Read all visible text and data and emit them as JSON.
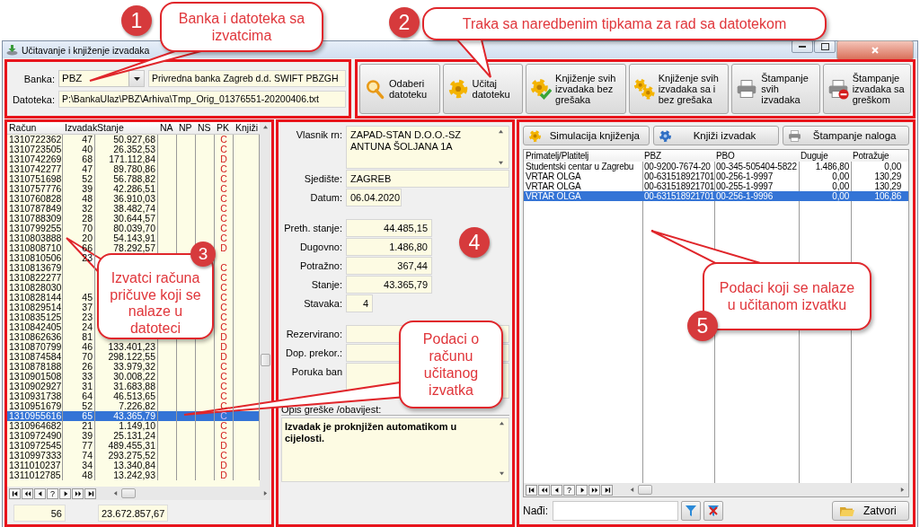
{
  "window": {
    "title": "Učitavanje i knjiženje izvadaka"
  },
  "bank": {
    "label": "Banka:",
    "code": "PBZ",
    "name": "Privredna banka Zagreb d.d. SWIFT PBZGH",
    "file_label": "Datoteka:",
    "file": "P:\\BankaUlaz\\PBZ\\Arhiva\\Tmp_Orig_01376551-20200406.txt"
  },
  "toolbar": [
    {
      "kind": "search",
      "label": "Odaberi datoteku"
    },
    {
      "kind": "gear",
      "label": "Učitaj datoteku"
    },
    {
      "kind": "gear-check",
      "label": "Knjiženje svih izvadaka bez grešaka"
    },
    {
      "kind": "gears",
      "label": "Knjiženje svih izvadaka sa i bez grešaka"
    },
    {
      "kind": "printer",
      "label": "Štampanje svih izvadaka"
    },
    {
      "kind": "printer-error",
      "label": "Štampanje izvadaka sa greškom"
    }
  ],
  "accounts": {
    "columns": [
      "Račun",
      "Izvadak",
      "Stanje",
      "NA",
      "NP",
      "NS",
      "PK",
      "Knjiži"
    ],
    "rows": [
      {
        "account": "1310722362",
        "statement": "47",
        "balance": "50.927,68",
        "pk": "C",
        "selected": false
      },
      {
        "account": "1310723505",
        "statement": "40",
        "balance": "26.352,53",
        "pk": "C",
        "selected": false
      },
      {
        "account": "1310742269",
        "statement": "68",
        "balance": "171.112,84",
        "pk": "D",
        "selected": false
      },
      {
        "account": "1310742277",
        "statement": "47",
        "balance": "89.780,86",
        "pk": "C",
        "selected": false
      },
      {
        "account": "1310751698",
        "statement": "52",
        "balance": "56.788,82",
        "pk": "C",
        "selected": false
      },
      {
        "account": "1310757776",
        "statement": "39",
        "balance": "42.286,51",
        "pk": "C",
        "selected": false
      },
      {
        "account": "1310760828",
        "statement": "48",
        "balance": "36.910,03",
        "pk": "C",
        "selected": false
      },
      {
        "account": "1310787849",
        "statement": "32",
        "balance": "38.482,74",
        "pk": "C",
        "selected": false
      },
      {
        "account": "1310788309",
        "statement": "28",
        "balance": "30.644,57",
        "pk": "C",
        "selected": false
      },
      {
        "account": "1310799255",
        "statement": "70",
        "balance": "80.039,70",
        "pk": "C",
        "selected": false
      },
      {
        "account": "1310803888",
        "statement": "20",
        "balance": "54.143,91",
        "pk": "C",
        "selected": false
      },
      {
        "account": "1310808710",
        "statement": "66",
        "balance": "78.292,57",
        "pk": "D",
        "selected": false
      },
      {
        "account": "1310810506",
        "statement": "23",
        "selected": false
      },
      {
        "account": "1310813679",
        "pk": "C",
        "selected": false
      },
      {
        "account": "1310822277",
        "pk": "C",
        "selected": false
      },
      {
        "account": "1310828030",
        "pk": "C",
        "selected": false
      },
      {
        "account": "1310828144",
        "statement": "45",
        "pk": "C",
        "selected": false
      },
      {
        "account": "1310829514",
        "statement": "37",
        "pk": "C",
        "selected": false
      },
      {
        "account": "1310835125",
        "statement": "23",
        "pk": "C",
        "selected": false
      },
      {
        "account": "1310842405",
        "statement": "24",
        "pk": "C",
        "selected": false
      },
      {
        "account": "1310862636",
        "statement": "81",
        "pk": "D",
        "selected": false
      },
      {
        "account": "1310870799",
        "statement": "46",
        "balance": "133.401,23",
        "pk": "D",
        "selected": false
      },
      {
        "account": "1310874584",
        "statement": "70",
        "balance": "298.122,55",
        "pk": "D",
        "selected": false
      },
      {
        "account": "1310878188",
        "statement": "26",
        "balance": "33.979,32",
        "pk": "C",
        "selected": false
      },
      {
        "account": "1310901508",
        "statement": "33",
        "balance": "30.008,22",
        "pk": "C",
        "selected": false
      },
      {
        "account": "1310902927",
        "statement": "31",
        "balance": "31.683,88",
        "pk": "C",
        "selected": false
      },
      {
        "account": "1310931738",
        "statement": "64",
        "balance": "46.513,65",
        "pk": "C",
        "selected": false
      },
      {
        "account": "1310951679",
        "statement": "52",
        "balance": "7.226,82",
        "pk": "C",
        "selected": false
      },
      {
        "account": "1310955616",
        "statement": "65",
        "balance": "43.365,79",
        "pk": "C",
        "selected": true
      },
      {
        "account": "1310964682",
        "statement": "21",
        "balance": "1.149,10",
        "pk": "C",
        "selected": false
      },
      {
        "account": "1310972490",
        "statement": "39",
        "balance": "25.131,24",
        "pk": "C",
        "selected": false
      },
      {
        "account": "1310972545",
        "statement": "77",
        "balance": "489.455,31",
        "pk": "D",
        "selected": false
      },
      {
        "account": "1310997333",
        "statement": "74",
        "balance": "293.275,52",
        "pk": "C",
        "selected": false
      },
      {
        "account": "1311010237",
        "statement": "34",
        "balance": "13.340,84",
        "pk": "D",
        "selected": false
      },
      {
        "account": "1311012785",
        "statement": "48",
        "balance": "13.242,93",
        "pk": "D",
        "selected": false
      }
    ],
    "pager": [
      {
        "kind": "first"
      },
      {
        "kind": "prev-page"
      },
      {
        "kind": "prev"
      },
      {
        "kind": "goto",
        "label": "?"
      },
      {
        "kind": "next"
      },
      {
        "kind": "next-page"
      },
      {
        "kind": "last"
      }
    ],
    "count": "56",
    "total": "23.672.857,67"
  },
  "account_details": {
    "groups": [
      [
        {
          "label": "Vlasnik rn:",
          "kind": "multiline",
          "value": "ZAPAD-STAN D.O.O.-SZ\nANTUNA ŠOLJANA 1A"
        },
        {
          "label": "Sjedište:",
          "kind": "text",
          "value": "ZAGREB"
        },
        {
          "label": "Datum:",
          "kind": "date",
          "value": "06.04.2020"
        }
      ],
      [
        {
          "label": "Preth. stanje:",
          "kind": "amount",
          "value": "44.485,15"
        },
        {
          "label": "Dugovno:",
          "kind": "amount",
          "value": "1.486,80"
        },
        {
          "label": "Potražno:",
          "kind": "amount",
          "value": "367,44"
        },
        {
          "label": "Stanje:",
          "kind": "amount",
          "value": "43.365,79"
        },
        {
          "label": "Stavaka:",
          "kind": "count",
          "value": "4"
        }
      ],
      [
        {
          "label": "Rezervirano:",
          "kind": "text"
        },
        {
          "label": "Dop. prekor.:",
          "kind": "text"
        },
        {
          "label": "Poruka ban",
          "kind": "note"
        }
      ]
    ],
    "message_label": "Opis greške /obavijest:",
    "message": "Izvadak je proknjižen automatikom u cijelosti."
  },
  "statement": {
    "buttons": [
      {
        "kind": "gear",
        "label": "Simulacija knjiženja"
      },
      {
        "kind": "gear-blue",
        "label": "Knjiži izvadak"
      },
      {
        "kind": "printer",
        "label": "Štampanje naloga"
      }
    ],
    "columns": [
      "Primatelj/Platitelj",
      "PBZ",
      "PBO",
      "Duguje",
      "Potražuje"
    ],
    "rows": [
      {
        "cells": [
          "Studentski centar u Zagrebu",
          "00-9200-7674-20",
          "00-345-505404-5822",
          "1.486,80",
          "0,00"
        ],
        "selected": false
      },
      {
        "cells": [
          "VRTAR OLGA",
          "00-631518921701",
          "00-256-1-9997",
          "0,00",
          "130,29"
        ],
        "selected": false
      },
      {
        "cells": [
          "VRTAR OLGA",
          "00-631518921701",
          "00-255-1-9997",
          "0,00",
          "130,29"
        ],
        "selected": false
      },
      {
        "cells": [
          "VRTAR OLGA",
          "00-631518921701",
          "00-256-1-9996",
          "0,00",
          "106,86"
        ],
        "selected": true
      }
    ],
    "pager": [
      {
        "kind": "first"
      },
      {
        "kind": "prev-page"
      },
      {
        "kind": "prev"
      },
      {
        "kind": "goto",
        "label": "?"
      },
      {
        "kind": "next"
      },
      {
        "kind": "next-page"
      },
      {
        "kind": "last"
      }
    ],
    "search_label": "Nađi:",
    "close_label": "Zatvori"
  },
  "annotations": [
    {
      "number": "1",
      "text": "Banka i datoteka sa izvatcima"
    },
    {
      "number": "2",
      "text": "Traka sa naredbenim tipkama za rad sa datotekom"
    },
    {
      "number": "3",
      "text": "Izvatci računa pričuve koji se nalaze u datoteci"
    },
    {
      "number": "4",
      "text": "Podaci o računu učitanog izvatka"
    },
    {
      "number": "5",
      "text": "Podaci koji se nalaze u učitanom izvatku"
    }
  ]
}
